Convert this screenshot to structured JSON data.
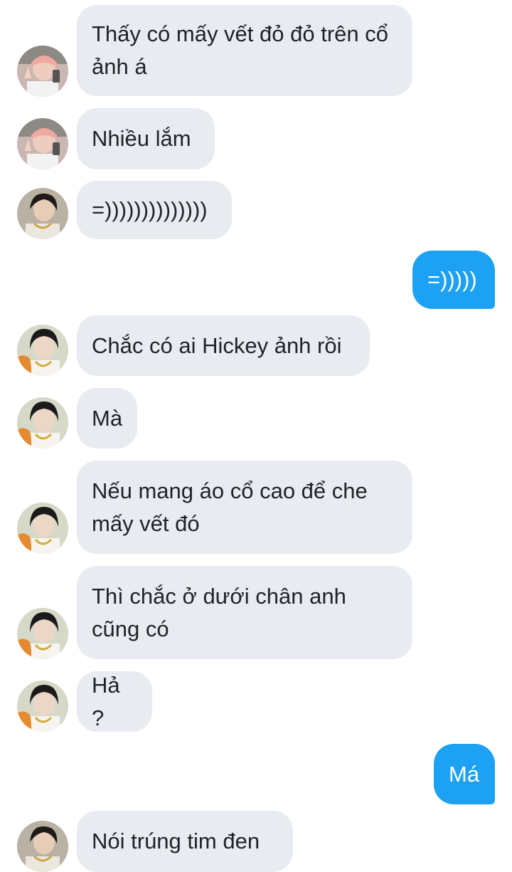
{
  "conversation": {
    "messages": [
      {
        "text": "Thấy có mấy vết đỏ đỏ trên cổ ảnh á",
        "from": "them",
        "avatar": "user-a-avatar"
      },
      {
        "text": "Nhiều lắm",
        "from": "them",
        "avatar": "user-a-avatar"
      },
      {
        "text": "=))))))))))))))",
        "from": "them",
        "avatar": "user-b-avatar"
      },
      {
        "text": "=)))))",
        "from": "me"
      },
      {
        "text": "Chắc có ai Hickey ảnh rồi",
        "from": "them",
        "avatar": "user-c-avatar"
      },
      {
        "text": "Mà",
        "from": "them",
        "avatar": "user-c-avatar"
      },
      {
        "text": "Nếu mang áo cổ cao để che mấy vết đó",
        "from": "them",
        "avatar": "user-c-avatar"
      },
      {
        "text": "Thì chắc ở dưới chân anh cũng có",
        "from": "them",
        "avatar": "user-c-avatar"
      },
      {
        "text": "Hả ?",
        "from": "them",
        "avatar": "user-c-avatar"
      },
      {
        "text": "Má",
        "from": "me"
      },
      {
        "text": "Nói trúng tim đen",
        "from": "them",
        "avatar": "user-b-avatar"
      }
    ]
  },
  "colors": {
    "incoming_bubble": "#e8ebef",
    "outgoing_bubble": "#1da1f2",
    "incoming_text": "#1f2328",
    "outgoing_text": "#ffffff"
  }
}
